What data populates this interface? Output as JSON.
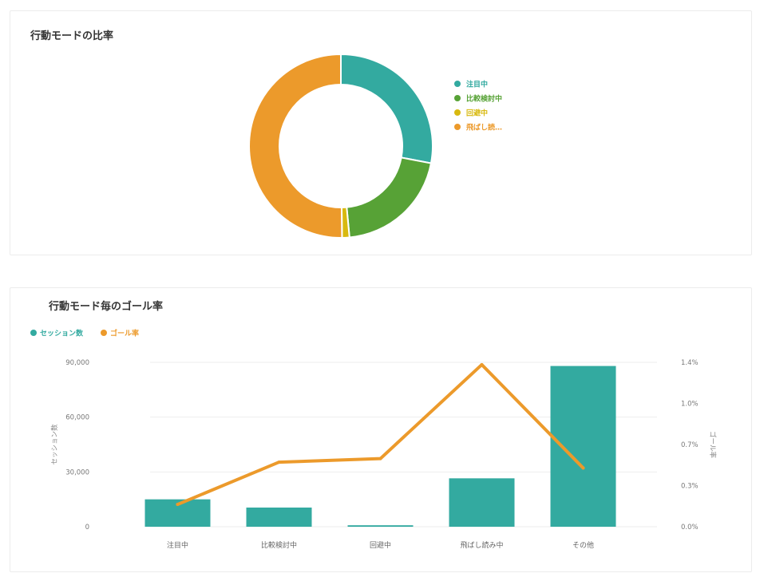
{
  "colors": {
    "teal": "#33aaa0",
    "green": "#57a236",
    "yellow": "#d8b90f",
    "orange": "#ec9a2b",
    "grid": "#eeeeee"
  },
  "charts": {
    "donut": {
      "title": "行動モードの比率"
    },
    "combo": {
      "title": "行動モード毎のゴール率"
    }
  },
  "chart_data": [
    {
      "type": "pie",
      "donut": true,
      "slices": [
        {
          "label": "注目中",
          "legend_text": "注目中",
          "value": 28.0,
          "color": "#33aaa0"
        },
        {
          "label": "比較検討中",
          "legend_text": "比較検討中",
          "value": 20.5,
          "color": "#57a236"
        },
        {
          "label": "回避中",
          "legend_text": "回避中",
          "value": 1.3,
          "color": "#d8b90f"
        },
        {
          "label": "飛ばし読み中",
          "legend_text": "飛ばし読…",
          "value": 50.2,
          "color": "#ec9a2b"
        }
      ],
      "legend_position": "right"
    },
    {
      "type": "bar",
      "categories": [
        "注目中",
        "比較検討中",
        "回避中",
        "飛ばし読み中",
        "その他"
      ],
      "series": [
        {
          "name": "セッション数",
          "kind": "bar",
          "axis": "left",
          "color": "#33aaa0",
          "values": [
            15000,
            10500,
            800,
            26500,
            88000
          ]
        },
        {
          "name": "ゴール率",
          "kind": "line",
          "axis": "right",
          "color": "#ec9a2b",
          "values": [
            0.19,
            0.55,
            0.58,
            1.38,
            0.5
          ]
        }
      ],
      "ylabel": "セッション数",
      "y2label": "ゴール率",
      "ylim": [
        0,
        90000
      ],
      "y2lim": [
        0,
        1.4
      ],
      "yticks": [
        "0",
        "30,000",
        "60,000",
        "90,000"
      ],
      "y2ticks": [
        "0.0%",
        "0.3%",
        "0.7%",
        "1.0%",
        "1.4%"
      ],
      "legend_position": "top-left",
      "grid": true
    }
  ]
}
